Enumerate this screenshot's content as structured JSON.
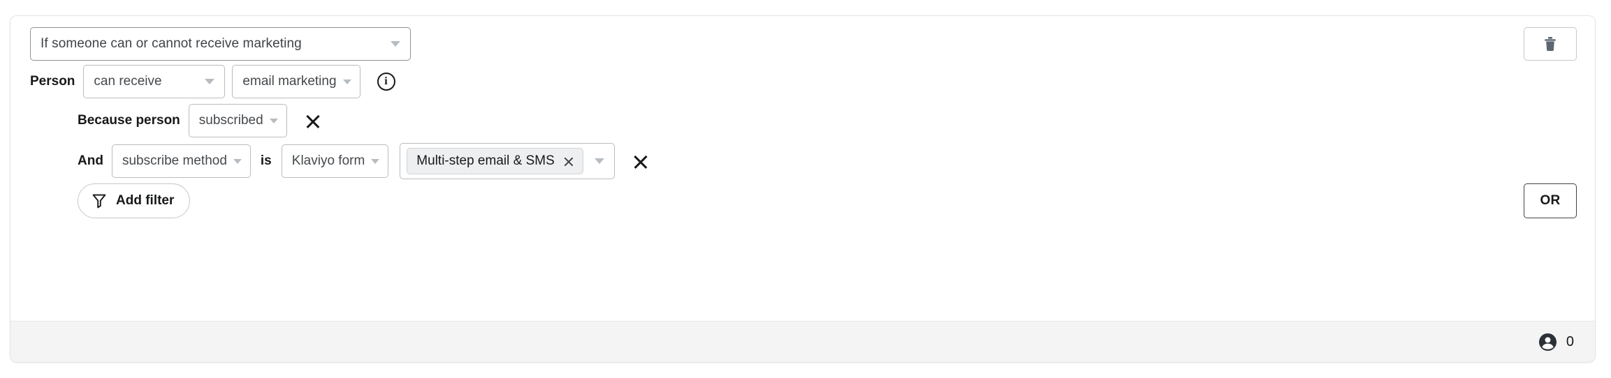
{
  "card": {
    "condition_select": {
      "value": "If someone can or cannot receive marketing",
      "caret_icon": "chevron-down-icon"
    },
    "delete_button": {
      "icon": "trash-icon",
      "label": ""
    },
    "person_row": {
      "label": "Person",
      "consent_select": {
        "value": "can receive",
        "caret_icon": "chevron-down-icon"
      },
      "channel_select": {
        "value": "email marketing",
        "caret_icon": "chevron-down-icon"
      },
      "info_icon": "info-circle-icon",
      "info_glyph": "i"
    },
    "because_row": {
      "label": "Because person",
      "reason_select": {
        "value": "subscribed",
        "caret_icon": "chevron-down-icon"
      },
      "remove_icon": "close-icon"
    },
    "and_row": {
      "label": "And",
      "property_select": {
        "value": "subscribe method",
        "caret_icon": "chevron-down-icon"
      },
      "operator_label": "is",
      "source_select": {
        "value": "Klaviyo form",
        "caret_icon": "chevron-down-icon"
      },
      "value_multiselect": {
        "tags": [
          {
            "label": "Multi-step email & SMS",
            "remove_icon": "close-icon"
          }
        ],
        "caret_icon": "chevron-down-icon"
      },
      "remove_icon": "close-icon"
    },
    "add_filter_button": {
      "label": "Add filter",
      "icon": "filter-funnel-icon"
    },
    "or_button": {
      "label": "OR"
    },
    "footer": {
      "profile_icon": "person-avatar-icon",
      "count": "0"
    }
  },
  "colors": {
    "page_background": "#ffffff",
    "card_background": "#ffffff",
    "card_border": "#e3e3e6",
    "footer_background": "#f4f4f5",
    "text_primary": "#16181a",
    "text_secondary": "#45494d",
    "field_border": "#b8bcc0",
    "emphasis_border": "#8f9194",
    "caret": "#b6bcc2",
    "tag_background": "#eeeff0",
    "trash_icon": "#5c6670"
  }
}
